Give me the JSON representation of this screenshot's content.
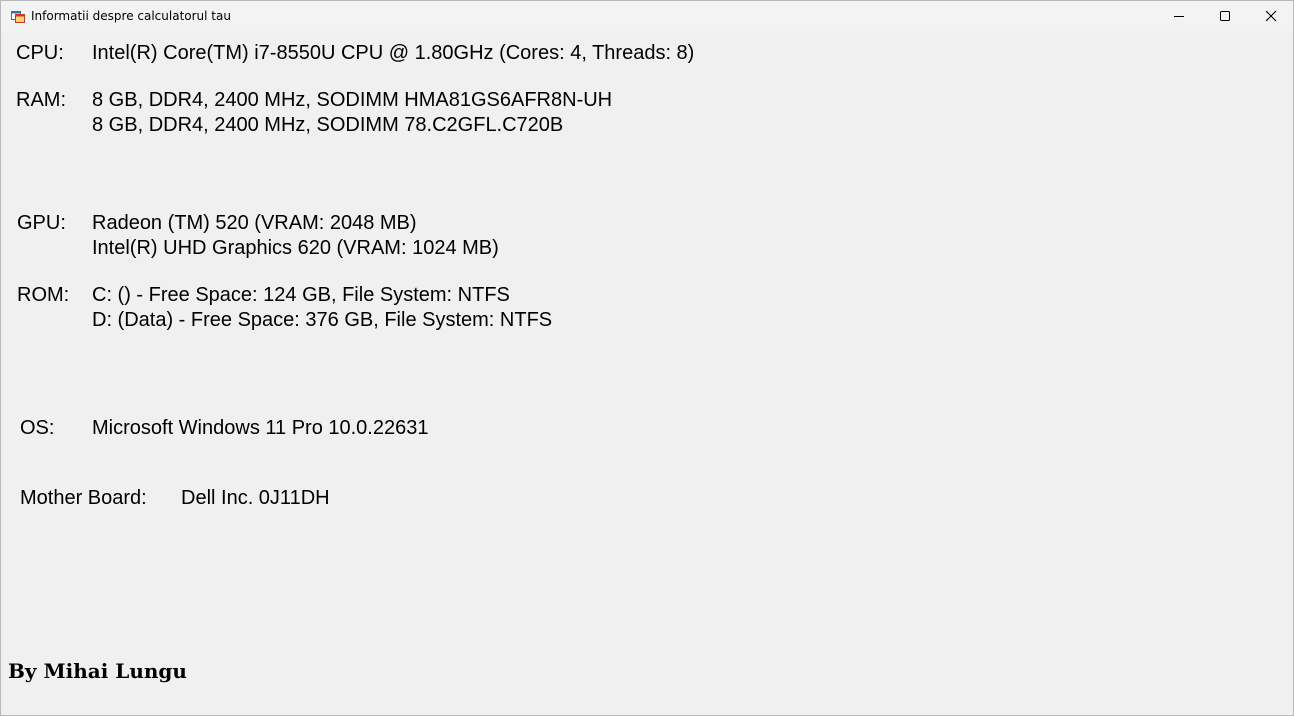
{
  "window": {
    "title": "Informatii despre calculatorul tau",
    "app_icon": "app-window-icon",
    "controls": {
      "minimize_icon": "minimize-icon",
      "maximize_icon": "maximize-icon",
      "close_icon": "close-icon"
    }
  },
  "specs": {
    "cpu": {
      "label": "CPU:",
      "lines": [
        "Intel(R) Core(TM) i7-8550U CPU @ 1.80GHz (Cores: 4, Threads: 8)"
      ]
    },
    "ram": {
      "label": "RAM:",
      "lines": [
        "8 GB, DDR4, 2400 MHz, SODIMM HMA81GS6AFR8N-UH",
        "8 GB, DDR4, 2400 MHz, SODIMM 78.C2GFL.C720B"
      ]
    },
    "gpu": {
      "label": "GPU:",
      "lines": [
        "Radeon (TM) 520 (VRAM: 2048 MB)",
        "Intel(R) UHD Graphics 620 (VRAM: 1024 MB)"
      ]
    },
    "rom": {
      "label": "ROM:",
      "lines": [
        "C: () - Free Space: 124 GB,  File System: NTFS",
        "D: (Data) - Free Space: 376 GB,  File System: NTFS"
      ]
    },
    "os": {
      "label": "OS:",
      "lines": [
        "Microsoft Windows 11 Pro 10.0.22631"
      ]
    },
    "motherboard": {
      "label": "Mother Board:",
      "value": "Dell Inc. 0J11DH"
    }
  },
  "footer": {
    "signature": "By Mihai Lungu"
  }
}
